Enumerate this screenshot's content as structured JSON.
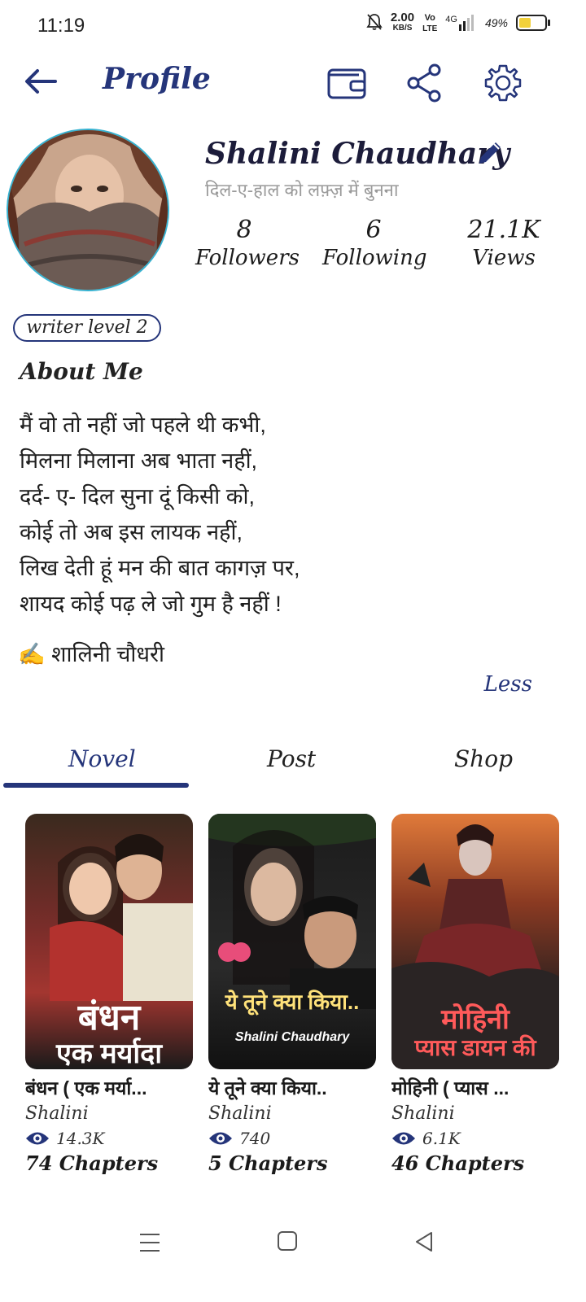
{
  "status_bar": {
    "time": "11:19",
    "net_speed": "2.00",
    "net_unit": "KB/S",
    "volte_top": "Vo",
    "volte_bottom": "LTE",
    "network": "4G",
    "battery": "49%"
  },
  "header": {
    "title": "Profile",
    "icons": [
      "back-arrow-icon",
      "wallet-icon",
      "share-icon",
      "gear-icon"
    ]
  },
  "profile": {
    "name": "Shalini Chaudhary",
    "tagline": "दिल-ए-हाल को लफ़्ज़ में बुनना",
    "stats": [
      {
        "value": "8",
        "label": "Followers"
      },
      {
        "value": "6",
        "label": "Following"
      },
      {
        "value": "21.1K",
        "label": "Views"
      }
    ],
    "level": "writer level 2"
  },
  "about": {
    "heading": "About Me",
    "text": "मैं वो तो नहीं जो पहले थी कभी,\nमिलना मिलाना अब भाता नहीं,\nदर्द- ए- दिल सुना दूं किसी को,\nकोई तो अब इस लायक नहीं,\nलिख देती हूं मन की बात कागज़ पर,\nशायद कोई पढ़ ले जो गुम है नहीं !",
    "signature_emoji": "✍️",
    "signature": "शालिनी चौधरी",
    "less": "Less"
  },
  "tabs": [
    {
      "label": "Novel",
      "active": true
    },
    {
      "label": "Post",
      "active": false
    },
    {
      "label": "Shop",
      "active": false
    }
  ],
  "books": [
    {
      "title": "बंधन ( एक मर्या...",
      "author": "Shalini",
      "views": "14.3K",
      "chapters": "74 Chapters",
      "cover_line1": "बंधन",
      "cover_line2": "एक मर्यादा"
    },
    {
      "title": "ये तूने क्या किया..",
      "author": "Shalini",
      "views": "740",
      "chapters": "5 Chapters",
      "cover_line1": "ये तूने क्या किया..",
      "cover_line2": "Shalini Chaudhary"
    },
    {
      "title": "मोहिनी ( प्यास ...",
      "author": "Shalini",
      "views": "6.1K",
      "chapters": "46 Chapters",
      "cover_line1": "मोहिनी",
      "cover_line2": "प्यास डायन की"
    }
  ],
  "colors": {
    "accent": "#25357a",
    "avatar_ring": "#36b2d1",
    "tagline": "#9a9a9a"
  }
}
